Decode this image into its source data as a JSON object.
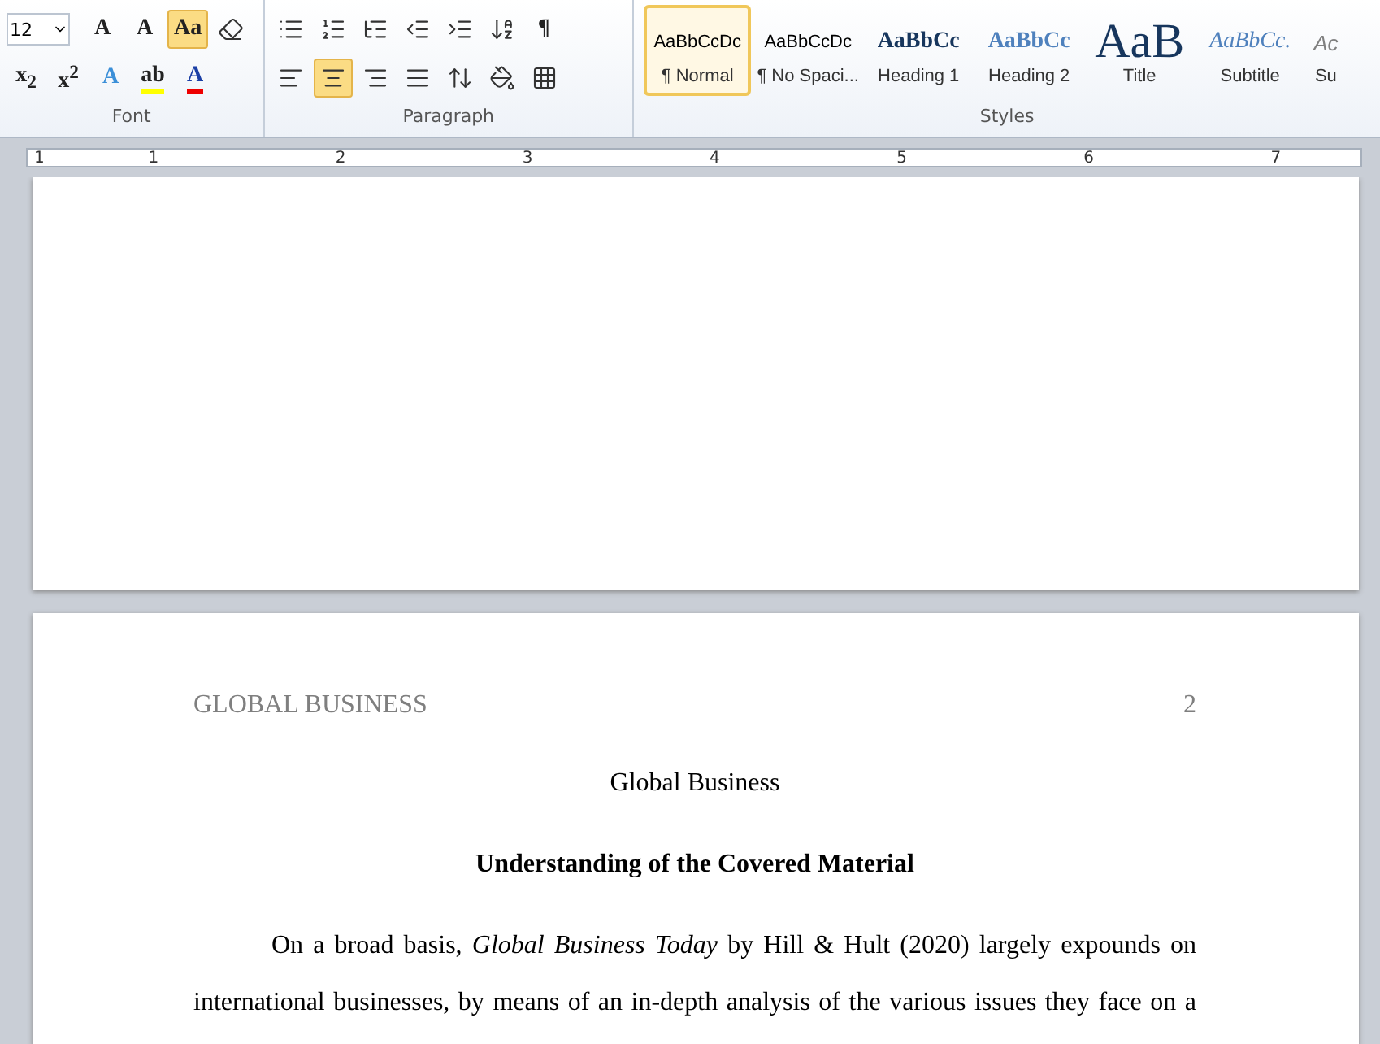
{
  "ribbon": {
    "font_group": {
      "label": "Font",
      "font_size": "12",
      "row1": [
        {
          "label": "A",
          "selected": false
        },
        {
          "label": "A",
          "selected": false
        },
        {
          "label": "Aa",
          "selected": true
        },
        {
          "selected": false
        }
      ],
      "row2": [
        {
          "label": "x$_{2}$",
          "selected": false
        },
        {
          "label": "x$^{2}$",
          "selected": false
        },
        {
          "label": "A",
          "selected": false
        },
        {
          "label": "ab",
          "selected": false
        },
        {
          "label": "A",
          "selected": false
        }
      ]
    },
    "paragraph_group": {
      "label": "Paragraph",
      "row1": [
        {
          "selected": false
        },
        {
          "selected": false
        },
        {
          "selected": false
        },
        {
          "selected": false
        },
        {
          "selected": false
        },
        {
          "selected": false
        },
        {
          "label": "¶",
          "selected": false
        }
      ],
      "row2": [
        {
          "selected": false
        },
        {
          "selected": true
        },
        {
          "selected": false
        },
        {
          "selected": false
        },
        {
          "selected": false
        },
        {
          "selected": false
        },
        {
          "selected": false
        }
      ]
    },
    "styles_group": {
      "label": "Styles",
      "styles": [
        {
          "kind": "normal",
          "preview": "AaBbCcDc",
          "name": "¶ Normal",
          "selected": true
        },
        {
          "kind": "plain",
          "preview": "AaBbCcDc",
          "name": "¶ No Spaci...",
          "selected": false
        },
        {
          "kind": "heading1",
          "preview": "AaBbCc",
          "name": "Heading 1",
          "selected": false
        },
        {
          "kind": "heading2",
          "preview": "AaBbCc",
          "name": "Heading 2",
          "selected": false
        },
        {
          "kind": "title",
          "preview": "AaB",
          "name": "Title",
          "selected": false
        },
        {
          "kind": "subtitle",
          "preview": "AaBbCc.",
          "name": "Subtitle",
          "selected": false
        },
        {
          "kind": "subtle",
          "preview": "Ac",
          "name": "Su",
          "selected": false
        }
      ]
    }
  },
  "ruler": {
    "numbers": [
      "1",
      "1",
      "2",
      "3",
      "4",
      "5",
      "6",
      "7"
    ]
  },
  "document": {
    "header_left": "GLOBAL BUSINESS",
    "page_number": "2",
    "title": "Global Business",
    "heading": "Understanding of the Covered Material",
    "paragraph_lines": [
      "On a broad basis, *Global Business Today* by Hill & Hult (2020) largely  expounds on",
      "international businesses, by means of an in-depth analysis  of the various issues they face on a"
    ]
  }
}
